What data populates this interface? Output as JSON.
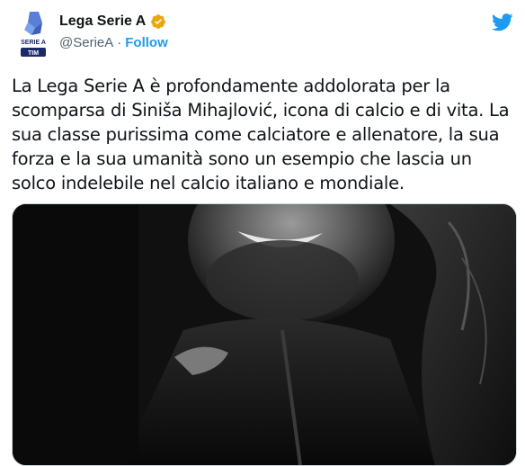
{
  "author": {
    "name": "Lega Serie A",
    "handle": "@SerieA",
    "separator": "·",
    "follow_label": "Follow",
    "verified_color": "#E8A80D",
    "avatar_text_top": "SERIE A",
    "avatar_text_bottom": "TIM"
  },
  "tweet": {
    "text": "La Lega Serie A è profondamente addolorata per la scomparsa di Siniša Mihajlović, icona di calcio e di vita. La sua classe purissima come calciatore e allenatore, la sua forza e la sua umanità sono un esempio che lascia un solco indelebile nel calcio italiano e mondiale."
  },
  "media": {
    "style": "black-and-white portrait photo",
    "icon": "photo"
  },
  "colors": {
    "accent": "#1d9bf0",
    "secondary_text": "#536471",
    "text": "#0f1419"
  }
}
